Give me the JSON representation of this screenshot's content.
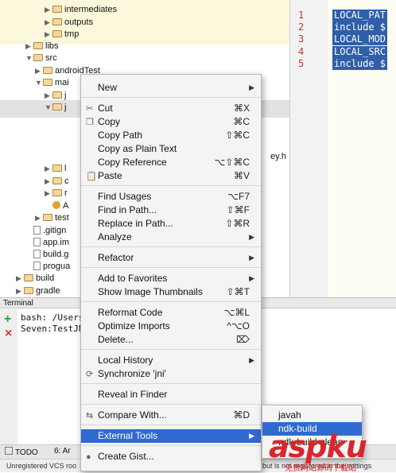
{
  "tree": {
    "rows": [
      {
        "label": "intermediates",
        "indent": 4,
        "type": "folder",
        "expanded": false
      },
      {
        "label": "outputs",
        "indent": 4,
        "type": "folder",
        "expanded": false
      },
      {
        "label": "tmp",
        "indent": 4,
        "type": "folder",
        "expanded": false
      },
      {
        "label": "libs",
        "indent": 2,
        "type": "folder",
        "expanded": false
      },
      {
        "label": "src",
        "indent": 2,
        "type": "folder",
        "expanded": true
      },
      {
        "label": "androidTest",
        "indent": 3,
        "type": "folder",
        "expanded": false
      },
      {
        "label": "mai",
        "indent": 3,
        "type": "folder",
        "expanded": true
      },
      {
        "label": "j",
        "indent": 4,
        "type": "folder",
        "expanded": false
      },
      {
        "label": "j",
        "indent": 4,
        "type": "folder",
        "expanded": true
      },
      {
        "label": "",
        "indent": 6,
        "type": "blank",
        "expanded": false
      },
      {
        "label": "",
        "indent": 6,
        "type": "blank",
        "expanded": false
      },
      {
        "label": "ey.h",
        "indent": 6,
        "type": "file",
        "expanded": false
      },
      {
        "label": "",
        "indent": 6,
        "type": "blank",
        "expanded": false
      },
      {
        "label": "l",
        "indent": 4,
        "type": "folder",
        "expanded": false
      },
      {
        "label": "c",
        "indent": 4,
        "type": "folder",
        "expanded": false
      },
      {
        "label": "r",
        "indent": 4,
        "type": "folder",
        "expanded": false
      },
      {
        "label": "A",
        "indent": 4,
        "type": "android",
        "expanded": false
      },
      {
        "label": "test",
        "indent": 3,
        "type": "folder",
        "expanded": false
      },
      {
        "label": ".gitign",
        "indent": 2,
        "type": "file",
        "expanded": false
      },
      {
        "label": "app.im",
        "indent": 2,
        "type": "file",
        "expanded": false
      },
      {
        "label": "build.g",
        "indent": 2,
        "type": "file",
        "expanded": false
      },
      {
        "label": "progua",
        "indent": 2,
        "type": "file",
        "expanded": false
      },
      {
        "label": "build",
        "indent": 1,
        "type": "folder",
        "expanded": false
      },
      {
        "label": "gradle",
        "indent": 1,
        "type": "folder",
        "expanded": false
      }
    ]
  },
  "editor": {
    "line_numbers": [
      "1",
      "2",
      "3",
      "4",
      "5"
    ],
    "lines": [
      "LOCAL_PAT",
      "include $",
      "LOCAL_MOD",
      "LOCAL_SRC",
      "include $"
    ]
  },
  "terminal": {
    "title": "Terminal",
    "lines": [
      "bash: /Users/s",
      "Seven:TestJNI"
    ],
    "add_icon": "+",
    "close_icon": "×"
  },
  "toolbar": {
    "todo_label": "TODO",
    "item2_label": "6: Ar"
  },
  "status": {
    "text_left": "Unregistered VCS roo",
    "text_right": "but is not registered in the settings"
  },
  "context_menu": {
    "items": [
      {
        "label": "New",
        "shortcut": "",
        "submenu": true,
        "icon": ""
      },
      {
        "sep": true
      },
      {
        "label": "Cut",
        "shortcut": "⌘X",
        "submenu": false,
        "icon": "✂"
      },
      {
        "label": "Copy",
        "shortcut": "⌘C",
        "submenu": false,
        "icon": "❐"
      },
      {
        "label": "Copy Path",
        "shortcut": "⇧⌘C",
        "submenu": false,
        "icon": ""
      },
      {
        "label": "Copy as Plain Text",
        "shortcut": "",
        "submenu": false,
        "icon": ""
      },
      {
        "label": "Copy Reference",
        "shortcut": "⌥⇧⌘C",
        "submenu": false,
        "icon": ""
      },
      {
        "label": "Paste",
        "shortcut": "⌘V",
        "submenu": false,
        "icon": "📋"
      },
      {
        "sep": true
      },
      {
        "label": "Find Usages",
        "shortcut": "⌥F7",
        "submenu": false,
        "icon": ""
      },
      {
        "label": "Find in Path...",
        "shortcut": "⇧⌘F",
        "submenu": false,
        "icon": ""
      },
      {
        "label": "Replace in Path...",
        "shortcut": "⇧⌘R",
        "submenu": false,
        "icon": ""
      },
      {
        "label": "Analyze",
        "shortcut": "",
        "submenu": true,
        "icon": ""
      },
      {
        "sep": true
      },
      {
        "label": "Refactor",
        "shortcut": "",
        "submenu": true,
        "icon": ""
      },
      {
        "sep": true
      },
      {
        "label": "Add to Favorites",
        "shortcut": "",
        "submenu": true,
        "icon": ""
      },
      {
        "label": "Show Image Thumbnails",
        "shortcut": "⇧⌘T",
        "submenu": false,
        "icon": ""
      },
      {
        "sep": true
      },
      {
        "label": "Reformat Code",
        "shortcut": "⌥⌘L",
        "submenu": false,
        "icon": ""
      },
      {
        "label": "Optimize Imports",
        "shortcut": "^⌥O",
        "submenu": false,
        "icon": ""
      },
      {
        "label": "Delete...",
        "shortcut": "⌦",
        "submenu": false,
        "icon": ""
      },
      {
        "sep": true
      },
      {
        "label": "Local History",
        "shortcut": "",
        "submenu": true,
        "icon": ""
      },
      {
        "label": "Synchronize 'jni'",
        "shortcut": "",
        "submenu": false,
        "icon": "⟳"
      },
      {
        "sep": true
      },
      {
        "label": "Reveal in Finder",
        "shortcut": "",
        "submenu": false,
        "icon": ""
      },
      {
        "sep": true
      },
      {
        "label": "Compare With...",
        "shortcut": "⌘D",
        "submenu": false,
        "icon": "⇆"
      },
      {
        "sep": true
      },
      {
        "label": "External Tools",
        "shortcut": "",
        "submenu": true,
        "icon": "",
        "active": true
      },
      {
        "sep": true
      },
      {
        "label": "Create Gist...",
        "shortcut": "",
        "submenu": false,
        "icon": "●"
      }
    ]
  },
  "submenu": {
    "items": [
      {
        "label": "javah",
        "active": false
      },
      {
        "label": "ndk-build",
        "active": true
      },
      {
        "label": "ndk-build-clean",
        "active": false
      }
    ]
  },
  "watermark": {
    "logo": "aspku",
    "sub": "免费网站源码下载站",
    "color": "#d8262c"
  }
}
